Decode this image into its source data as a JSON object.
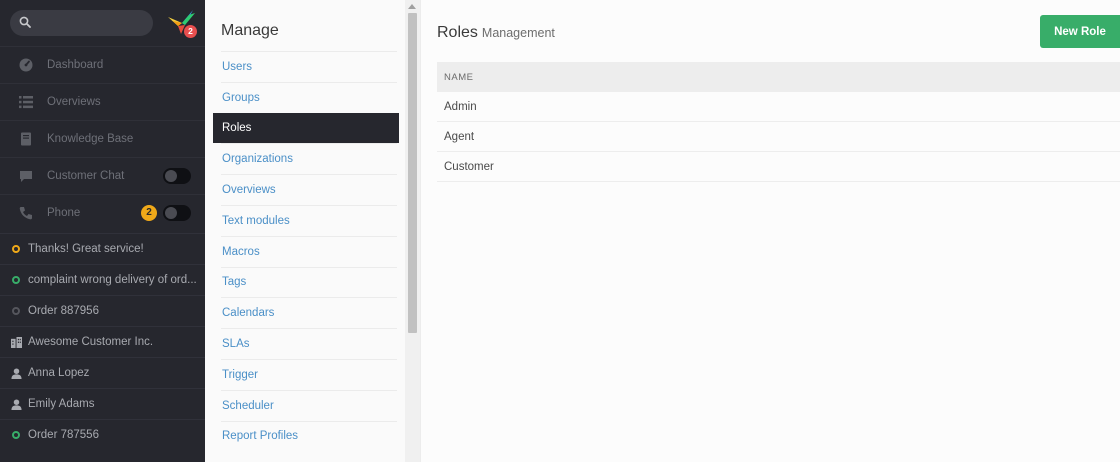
{
  "sidebar": {
    "logo_badge": "2",
    "nav": [
      {
        "label": "Dashboard",
        "icon": "dashboard-icon"
      },
      {
        "label": "Overviews",
        "icon": "list-icon"
      },
      {
        "label": "Knowledge Base",
        "icon": "book-icon"
      },
      {
        "label": "Customer Chat",
        "icon": "chat-icon"
      },
      {
        "label": "Phone",
        "icon": "phone-icon",
        "badge": "2"
      }
    ],
    "tasks": [
      {
        "label": "Thanks! Great service!",
        "icon": "ticket-open-icon",
        "color": "#f0a919"
      },
      {
        "label": "complaint wrong delivery of ord...",
        "icon": "ticket-new-icon",
        "color": "#38ad69"
      },
      {
        "label": "Order 887956",
        "icon": "ticket-closed-icon",
        "color": "#55565d"
      },
      {
        "label": "Awesome Customer Inc.",
        "icon": "organization-icon"
      },
      {
        "label": "Anna Lopez",
        "icon": "user-icon"
      },
      {
        "label": "Emily Adams",
        "icon": "user-icon"
      },
      {
        "label": "Order 787556",
        "icon": "ticket-new-icon",
        "color": "#38ad69"
      }
    ]
  },
  "manage": {
    "title": "Manage",
    "items": [
      "Users",
      "Groups",
      "Roles",
      "Organizations",
      "Overviews",
      "Text modules",
      "Macros",
      "Tags",
      "Calendars",
      "SLAs",
      "Trigger",
      "Scheduler",
      "Report Profiles"
    ],
    "active": "Roles"
  },
  "main": {
    "title": "Roles",
    "subtitle": "Management",
    "new_button": "New Role",
    "table": {
      "header": "NAME",
      "rows": [
        "Admin",
        "Agent",
        "Customer"
      ]
    }
  },
  "colors": {
    "sidebar_bg": "#26272e",
    "link": "#4a8fc7",
    "accent_green": "#38ad69",
    "badge_yellow": "#f0a919",
    "badge_red": "#e84f4f"
  }
}
